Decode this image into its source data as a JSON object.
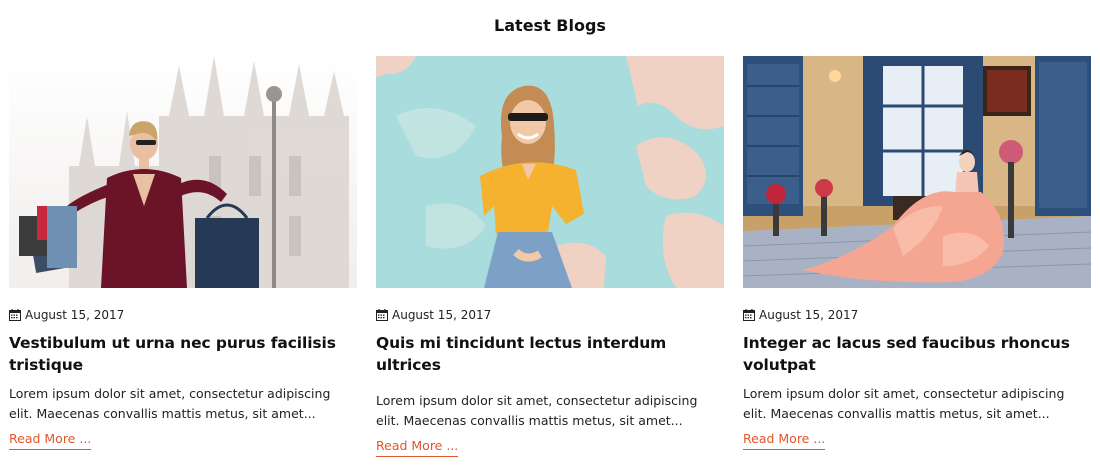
{
  "section": {
    "title": "Latest Blogs"
  },
  "posts": [
    {
      "image_alt": "Woman with shopping bags in front of cathedral",
      "date": "August 15, 2017",
      "title": "Vestibulum ut urna nec purus facilisis tristique",
      "excerpt": "Lorem ipsum dolor sit amet, consectetur adipiscing elit. Maecenas convallis mattis metus, sit amet...",
      "read_more": "Read More ..."
    },
    {
      "image_alt": "Smiling woman in yellow shirt against teal wall",
      "date": "August 15, 2017",
      "title": "Quis mi tincidunt lectus interdum ultrices",
      "excerpt": "Lorem ipsum dolor sit amet, consectetur adipiscing elit. Maecenas convallis mattis metus, sit amet...",
      "read_more": "Read More ..."
    },
    {
      "image_alt": "Woman in pink ball gown in sunlit room",
      "date": "August 15, 2017",
      "title": "Integer ac lacus sed faucibus rhoncus volutpat",
      "excerpt": "Lorem ipsum dolor sit amet, consectetur adipiscing elit. Maecenas convallis mattis metus, sit amet...",
      "read_more": "Read More ..."
    }
  ],
  "icons": {
    "date": "calendar-icon"
  },
  "colors": {
    "accent": "#e2562c",
    "text": "#111111"
  }
}
